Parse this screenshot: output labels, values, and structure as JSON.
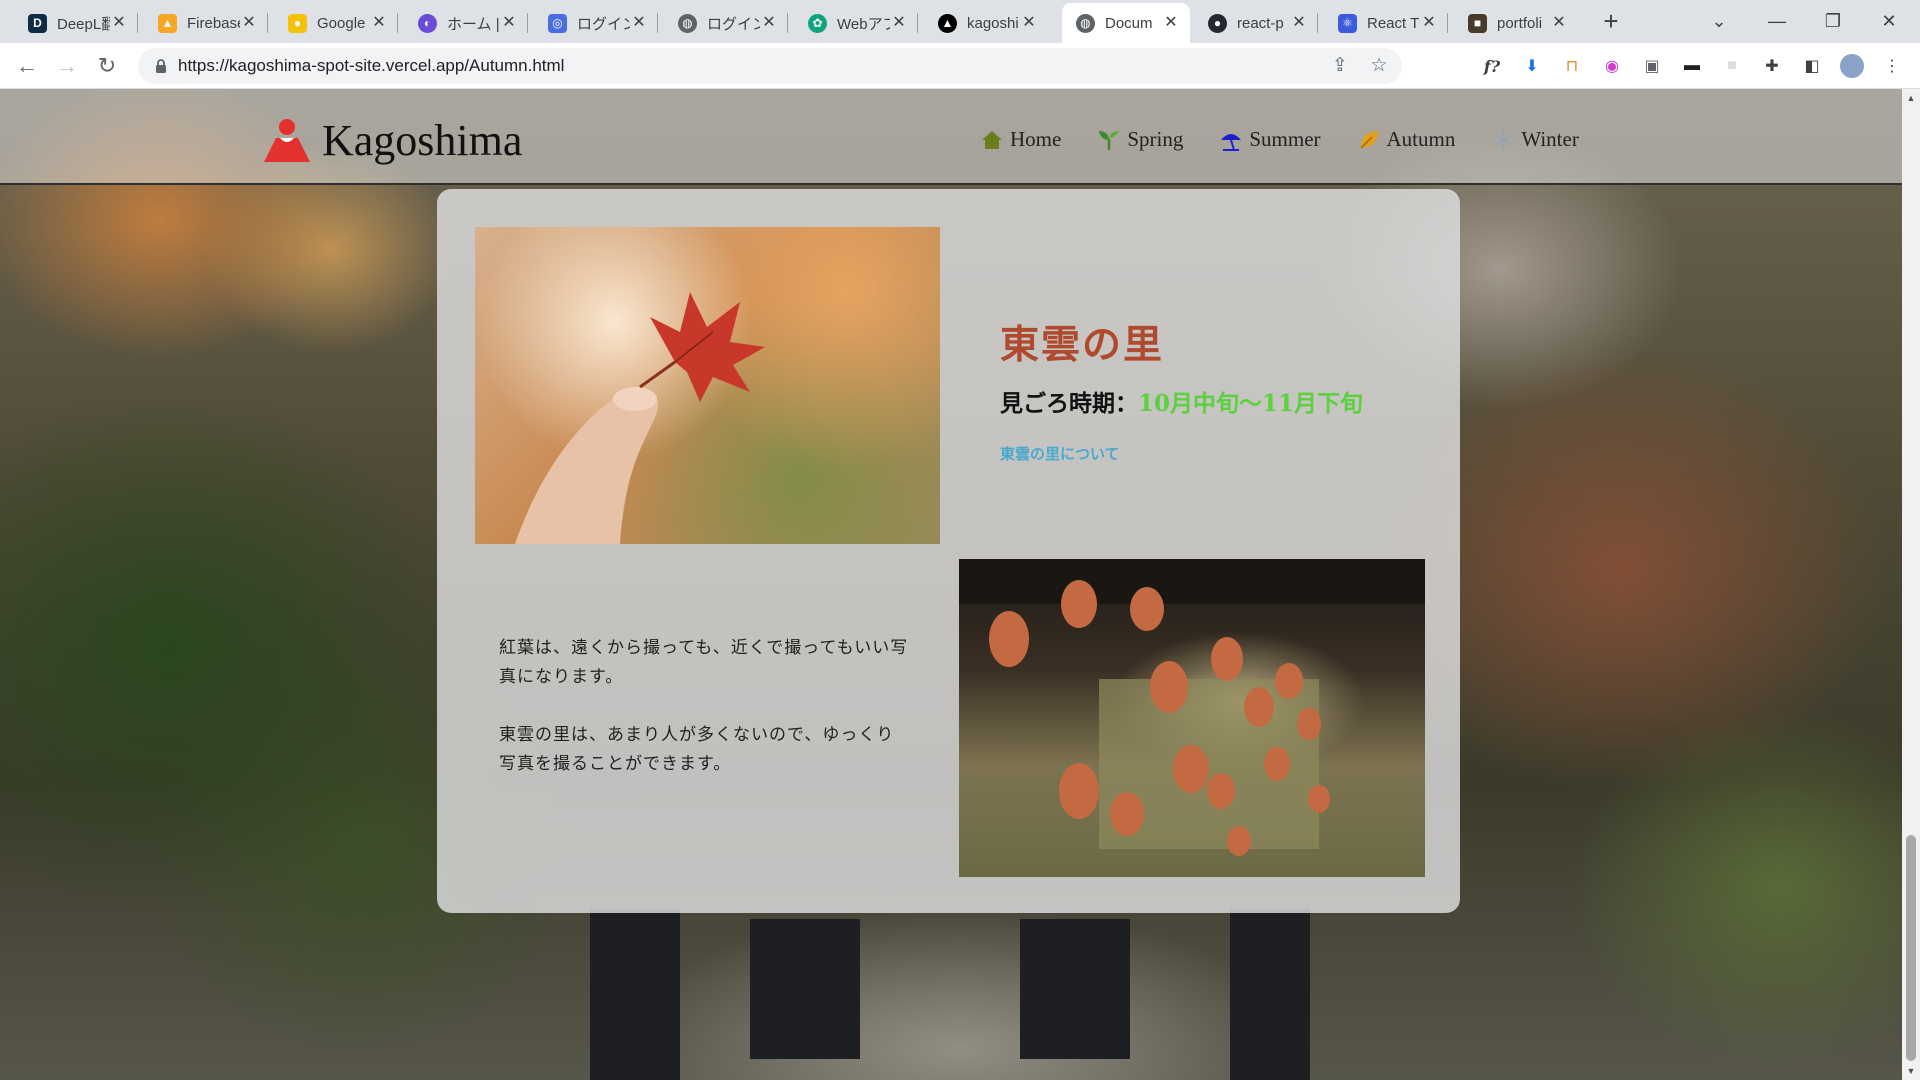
{
  "browser": {
    "tabs": [
      {
        "title": "DeepL翻訳",
        "favicon": "deepl-icon",
        "color": "#0f2b46"
      },
      {
        "title": "Firebase",
        "favicon": "firebase-icon",
        "color": "#f6a623"
      },
      {
        "title": "Google",
        "favicon": "google-keep-icon",
        "color": "#f4c20d"
      },
      {
        "title": "ホーム | N",
        "favicon": "app-icon",
        "color": "#6a4cd6"
      },
      {
        "title": "ログイン画",
        "favicon": "login-icon",
        "color": "#4a6ee0"
      },
      {
        "title": "ログイン画",
        "favicon": "globe-icon",
        "color": "#5f6368"
      },
      {
        "title": "Webアプ",
        "favicon": "openai-icon",
        "color": "#10a37f"
      },
      {
        "title": "kagoshi",
        "favicon": "vercel-icon",
        "color": "#000000"
      },
      {
        "title": "Docum",
        "favicon": "globe-icon",
        "color": "#5f6368"
      },
      {
        "title": "react-p",
        "favicon": "github-icon",
        "color": "#24292f"
      },
      {
        "title": "React T",
        "favicon": "react-icon",
        "color": "#3b5bdb"
      },
      {
        "title": "portfoli",
        "favicon": "portfolio-icon",
        "color": "#4a3a2a"
      }
    ],
    "active_tab_index": 8,
    "url": "https://kagoshima-spot-site.vercel.app/Autumn.html"
  },
  "site": {
    "logo_text": "Kagoshima",
    "nav": [
      {
        "label": "Home",
        "icon": "house-icon",
        "color": "#6b7d1e"
      },
      {
        "label": "Spring",
        "icon": "sprout-icon",
        "color": "#3f8a2a"
      },
      {
        "label": "Summer",
        "icon": "beach-umbrella-icon",
        "color": "#1f1fd0"
      },
      {
        "label": "Autumn",
        "icon": "leaf-icon",
        "color": "#e0a020"
      },
      {
        "label": "Winter",
        "icon": "snowflake-icon",
        "color": "#9aa4ad"
      }
    ],
    "spot": {
      "title": "東雲の里",
      "period_label": "見ごろ時期：",
      "period_value": "10月中旬〜11月下旬",
      "link_text": "東雲の里について",
      "paragraphs": [
        "紅葉は、遠くから撮っても、近くで撮ってもいい写真になります。",
        "東雲の里は、あまり人が多くないので、ゆっくり写真を撮ることができます。"
      ]
    }
  },
  "colors": {
    "title": "#b04a2e",
    "period_value": "#5ad13d",
    "link": "#4aa9cf"
  }
}
